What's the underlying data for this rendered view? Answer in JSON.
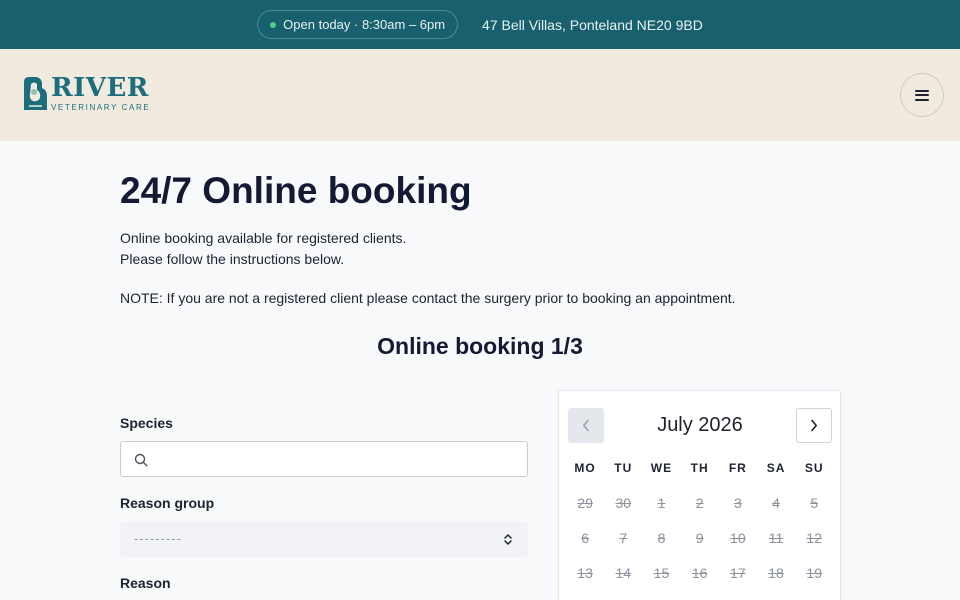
{
  "topbar": {
    "hours": "Open today · 8:30am – 6pm",
    "address": "47 Bell Villas, Ponteland NE20 9BD",
    "status_color": "#4ccf88"
  },
  "header": {
    "logo_text": "RIVER",
    "logo_subtext": "VETERINARY CARE",
    "menu_icon": "hamburger-icon"
  },
  "main": {
    "title": "24/7 Online booking",
    "intro_line1": "Online booking available for registered clients.",
    "intro_line2": "Please follow the instructions below.",
    "note": "NOTE: If you are not a registered client please contact the surgery prior to booking an appointment.",
    "step_title": "Online booking 1/3"
  },
  "form": {
    "species_label": "Species",
    "species_value": "",
    "reason_group_label": "Reason group",
    "reason_group_value": "---------",
    "reason_label": "Reason"
  },
  "calendar": {
    "month": "July 2026",
    "weekdays": [
      "MO",
      "TU",
      "WE",
      "TH",
      "FR",
      "SA",
      "SU"
    ],
    "days": [
      "29",
      "30",
      "1",
      "2",
      "3",
      "4",
      "5",
      "6",
      "7",
      "8",
      "9",
      "10",
      "11",
      "12",
      "13",
      "14",
      "15",
      "16",
      "17",
      "18",
      "19"
    ],
    "unavailable": true
  },
  "colors": {
    "topbar": "#18606e",
    "header": "#f1ebdf",
    "brand": "#1c6e7c"
  }
}
